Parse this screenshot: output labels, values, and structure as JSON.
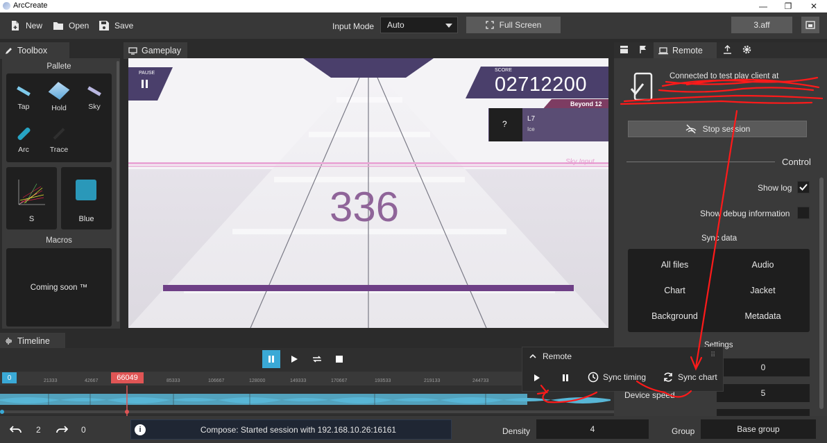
{
  "window": {
    "title": "ArcCreate",
    "minimize": "—",
    "maximize": "❐",
    "close": "✕"
  },
  "toolbar": {
    "new_label": "New",
    "open_label": "Open",
    "save_label": "Save",
    "input_mode_label": "Input Mode",
    "input_mode_value": "Auto",
    "fullscreen_label": "Full Screen",
    "file_name": "3.aff"
  },
  "tabs": {
    "toolbox": "Toolbox",
    "gameplay": "Gameplay",
    "remote": "Remote",
    "timeline": "Timeline"
  },
  "toolbox": {
    "pallete_title": "Pallete",
    "items": [
      "Tap",
      "Hold",
      "Sky",
      "Arc",
      "Trace"
    ],
    "s_label": "S",
    "blue_label": "Blue",
    "macros_title": "Macros",
    "macros_text": "Coming soon ™"
  },
  "game": {
    "pause_label": "PAUSE",
    "score_label": "SCORE",
    "score": "02712200",
    "difficulty": "Beyond 12",
    "jacket_mark": "?",
    "song_title": "L7",
    "song_artist": "Ice",
    "sky_input": "Sky Input",
    "combo": "336"
  },
  "remote_panel": {
    "connected_text": "Connected to test play client at",
    "stop_label": "Stop session",
    "control_title": "Control",
    "show_log_label": "Show log",
    "show_log_checked": true,
    "show_debug_label": "Show debug information",
    "show_debug_checked": false,
    "sync_data_title": "Sync data",
    "sync_items": [
      "All files",
      "Audio",
      "Chart",
      "Jacket",
      "Background",
      "Metadata"
    ],
    "settings_title": "Settings",
    "field1_value": "0",
    "device_speed_label": "Device speed",
    "device_speed_value": "5"
  },
  "timeline": {
    "start_marker": "0",
    "cursor_value": "66049",
    "ticks": [
      "21333",
      "42667",
      "85333",
      "106667",
      "128000",
      "149333",
      "170667",
      "193533",
      "219133",
      "244733"
    ]
  },
  "remote_popup": {
    "title": "Remote",
    "sync_timing": "Sync timing",
    "sync_chart": "Sync chart"
  },
  "status": {
    "undo_count": "2",
    "redo_count": "0",
    "message": "Compose: Started session with 192.168.10.26:16161",
    "density_label": "Density",
    "density_value": "4",
    "group_label": "Group",
    "group_value": "Base group"
  },
  "colors": {
    "accent_blue": "#3aa9d6",
    "cursor_red": "#e05555",
    "waveform": "#58b6d6",
    "annotation_red": "#ff1a1a"
  }
}
